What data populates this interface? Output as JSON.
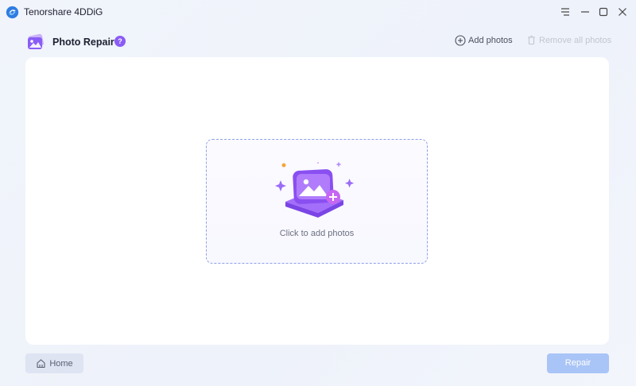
{
  "window": {
    "title": "Tenorshare 4DDiG",
    "controls": [
      "menu-icon",
      "minimize-icon",
      "maximize-icon",
      "close-icon"
    ]
  },
  "header": {
    "feature_title": "Photo Repair",
    "help_label": "?",
    "add_photos_label": "Add photos",
    "remove_all_label": "Remove all photos"
  },
  "dropzone": {
    "label": "Click to add photos",
    "icon": "add-photo-illustration"
  },
  "footer": {
    "home_label": "Home",
    "repair_label": "Repair"
  },
  "colors": {
    "accent_purple": "#8a5cf6",
    "dropzone_border": "#8ea1e6",
    "repair_button": "#a9c4f6",
    "home_button": "#dfe4f3",
    "disabled_text": "#c3c6d1"
  }
}
